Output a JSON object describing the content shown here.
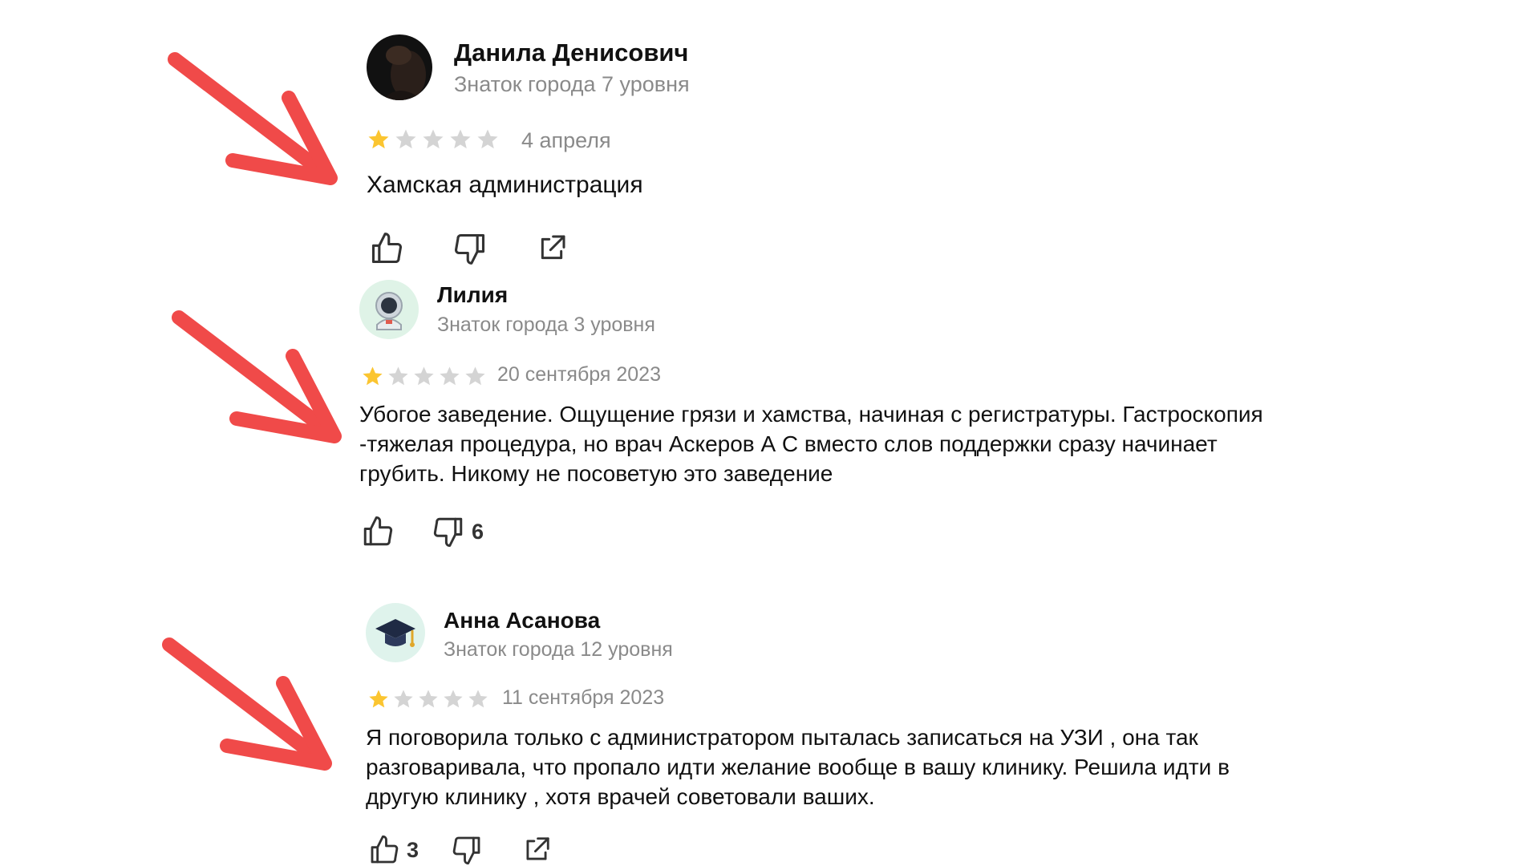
{
  "colors": {
    "star_filled": "#fbc530",
    "star_empty": "#d4d4d4",
    "arrow": "#f04a49",
    "secondary_text": "#8a8a8a"
  },
  "reviews": [
    {
      "author": "Данила Денисович",
      "level": "Знаток города 7 уровня",
      "rating": 1,
      "rating_max": 5,
      "date": "4 апреля",
      "text": "Хамская администрация",
      "likes": "",
      "dislikes": "",
      "avatar_icon": "user-photo-avatar"
    },
    {
      "author": "Лилия",
      "level": "Знаток города 3 уровня",
      "rating": 1,
      "rating_max": 5,
      "date": "20 сентября 2023",
      "text": "Убогое заведение. Ощущение грязи и хамства, начиная с регистратуры. Гастроскопия -тяжелая процедура, но врач Аскеров А С вместо слов поддержки сразу начинает грубить. Никому не посоветую это заведение",
      "likes": "",
      "dislikes": "6",
      "avatar_icon": "astronaut-avatar"
    },
    {
      "author": "Анна Асанова",
      "level": "Знаток города 12 уровня",
      "rating": 1,
      "rating_max": 5,
      "date": "11 сентября 2023",
      "text": "Я поговорила только с администратором пыталась записаться на УЗИ , она так разговаривала, что пропало идти желание вообще в вашу клинику. Решила идти в другую клинику , хотя врачей советовали ваших.",
      "likes": "3",
      "dislikes": "",
      "avatar_icon": "graduation-cap-avatar"
    }
  ]
}
